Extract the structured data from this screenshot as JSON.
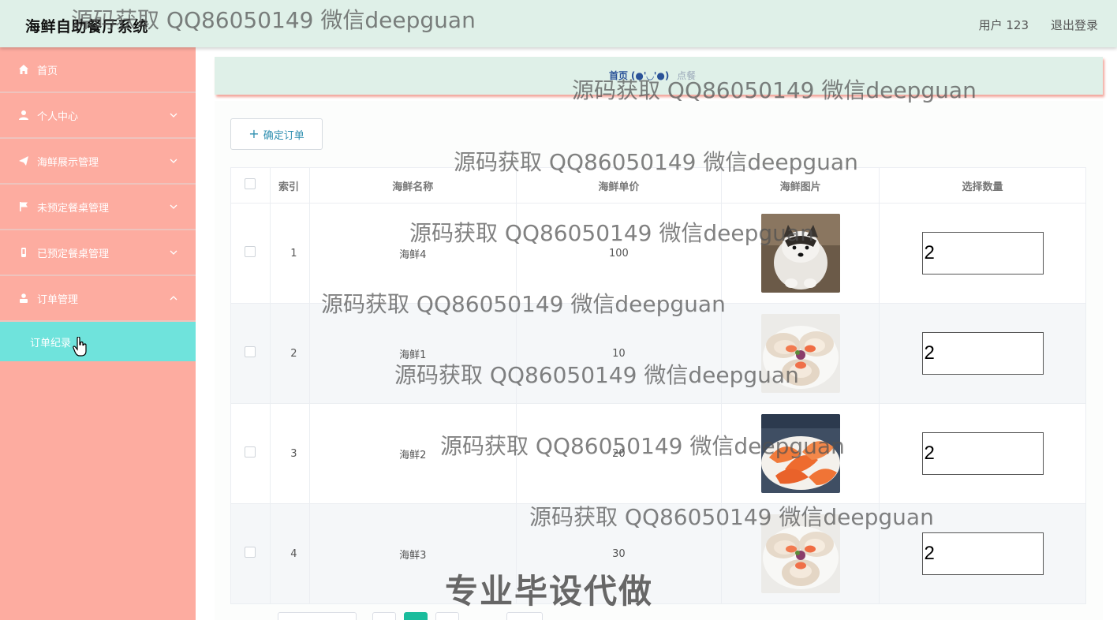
{
  "header": {
    "app_title": "海鲜自助餐厅系统",
    "user_label": "用户 123",
    "logout_label": "退出登录"
  },
  "sidebar": {
    "items": [
      {
        "label": "首页",
        "icon": "home-icon"
      },
      {
        "label": "个人中心",
        "icon": "user-icon"
      },
      {
        "label": "海鲜展示管理",
        "icon": "send-icon"
      },
      {
        "label": "未预定餐桌管理",
        "icon": "flag-icon"
      },
      {
        "label": "已预定餐桌管理",
        "icon": "phone-icon"
      },
      {
        "label": "订单管理",
        "icon": "person-icon"
      }
    ],
    "sub_item": "订单纪录"
  },
  "breadcrumb": {
    "home": "首页",
    "emoticon": "(●'◡'●)",
    "current": "点餐"
  },
  "toolbar": {
    "confirm_label": "确定订单"
  },
  "table": {
    "headers": [
      "索引",
      "海鲜名称",
      "海鲜单价",
      "海鲜图片",
      "选择数量"
    ],
    "rows": [
      {
        "index": "1",
        "name": "海鲜4",
        "price": "100",
        "image": "dog-photo",
        "qty": "2"
      },
      {
        "index": "2",
        "name": "海鲜1",
        "price": "10",
        "image": "scallop-photo",
        "qty": "2"
      },
      {
        "index": "3",
        "name": "海鲜2",
        "price": "20",
        "image": "shrimp-photo",
        "qty": "2"
      },
      {
        "index": "4",
        "name": "海鲜3",
        "price": "30",
        "image": "scallop-photo",
        "qty": "2"
      }
    ]
  },
  "watermarks": {
    "text": "源码获取 QQ86050149 微信deepguan",
    "banner": "专业毕设代做"
  },
  "colors": {
    "header_bg": "#dff0e8",
    "sidebar_bg": "#fdaca0",
    "active_sub_bg": "#6fe3dc",
    "accent": "#2f8fb0"
  }
}
